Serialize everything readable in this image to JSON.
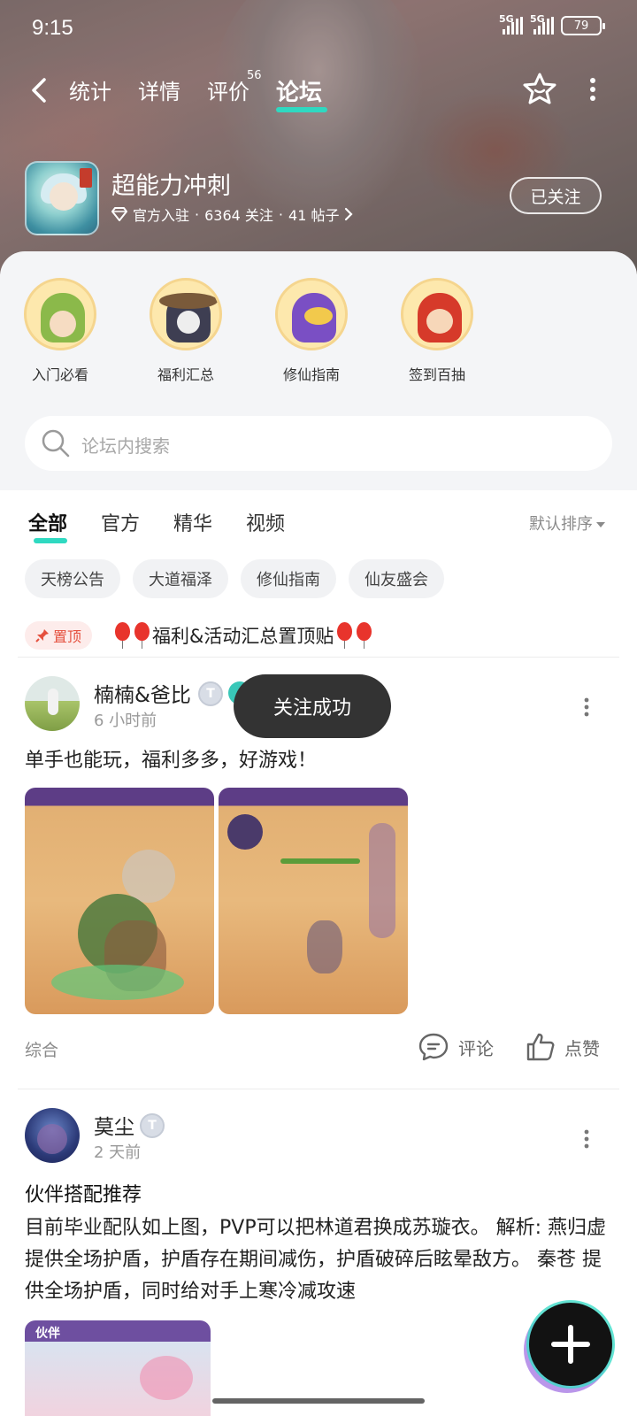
{
  "status_bar": {
    "time": "9:15",
    "sim1": "5G",
    "sim2": "5G",
    "battery": "79"
  },
  "nav": {
    "tabs": [
      {
        "label": "统计"
      },
      {
        "label": "详情"
      },
      {
        "label": "评价",
        "badge": "56"
      },
      {
        "label": "论坛",
        "active": true
      }
    ]
  },
  "game": {
    "title": "超能力冲刺",
    "official": "官方入驻",
    "followers": "6364 关注",
    "posts": "41 帖子",
    "follow_label": "已关注"
  },
  "categories": [
    {
      "label": "入门必看"
    },
    {
      "label": "福利汇总"
    },
    {
      "label": "修仙指南"
    },
    {
      "label": "签到百抽"
    }
  ],
  "search": {
    "placeholder": "论坛内搜索"
  },
  "feed_tabs": [
    {
      "label": "全部",
      "active": true
    },
    {
      "label": "官方"
    },
    {
      "label": "精华"
    },
    {
      "label": "视频"
    }
  ],
  "sort_label": "默认排序",
  "chips": [
    "天榜公告",
    "大道福泽",
    "修仙指南",
    "仙友盛会"
  ],
  "pinned": {
    "badge": "置顶",
    "title": "福利&活动汇总置顶贴"
  },
  "toast": "关注成功",
  "posts": [
    {
      "author": "楠楠&爸比",
      "level": "T",
      "time": "6 小时前",
      "text": "单手也能玩，福利多多，好游戏！",
      "tag": "综合",
      "comment_label": "评论",
      "like_label": "点赞"
    },
    {
      "author": "莫尘",
      "level": "T",
      "time": "2 天前",
      "title": "伙伴搭配推荐",
      "text": "目前毕业配队如上图，PVP可以把林道君换成苏璇衣。 解析: 燕归虚 提供全场护盾，护盾存在期间减伤，护盾破碎后眩晕敌方。 秦苍 提供全场护盾，同时给对手上寒冷减攻速",
      "image_label": "伙伴"
    }
  ],
  "colors": {
    "accent": "#2fd9c1",
    "pin": "#e5503e",
    "toast_bg": "#333333"
  }
}
